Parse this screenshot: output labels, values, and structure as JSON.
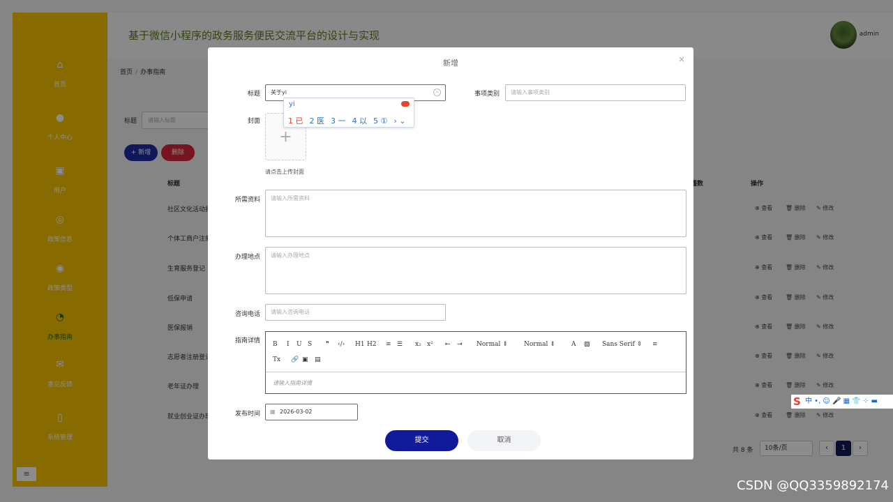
{
  "app": {
    "title": "基于微信小程序的政务服务便民交流平台的设计与实现",
    "username": "admin"
  },
  "sidebar": {
    "items": [
      {
        "label": "首页",
        "icon": "home-icon",
        "glyph": "⌂"
      },
      {
        "label": "个人中心",
        "icon": "user-icon",
        "glyph": "●"
      },
      {
        "label": "用户",
        "icon": "users-icon",
        "glyph": "▣"
      },
      {
        "label": "政策信息",
        "icon": "policy-icon",
        "glyph": "◎"
      },
      {
        "label": "政策类型",
        "icon": "category-icon",
        "glyph": "◉"
      },
      {
        "label": "办事指南",
        "icon": "guide-icon",
        "glyph": "◔"
      },
      {
        "label": "意见反馈",
        "icon": "mail-icon",
        "glyph": "✉"
      },
      {
        "label": "系统管理",
        "icon": "system-icon",
        "glyph": "▯"
      }
    ],
    "toggle_glyph": "≡"
  },
  "breadcrumb": {
    "home": "首页",
    "sep": "/",
    "current": "办事指南"
  },
  "search": {
    "label": "标题",
    "placeholder": "请输入标题"
  },
  "actions": {
    "add": "+ 新增",
    "delete": "删除"
  },
  "table": {
    "headers": {
      "title": "标题",
      "count": "播数",
      "ops": "操作"
    },
    "rows": [
      {
        "title": "社区文化活动报"
      },
      {
        "title": "个体工商户注册"
      },
      {
        "title": "生育服务登记"
      },
      {
        "title": "低保申请"
      },
      {
        "title": "医保报销"
      },
      {
        "title": "志愿者注册登记"
      },
      {
        "title": "老年证办理"
      },
      {
        "title": "就业创业证办理"
      }
    ],
    "row_actions": {
      "view": "⊕ 查看",
      "delete": "🗑 删除",
      "edit": "✎ 修改"
    }
  },
  "pager": {
    "total": "共 8 条",
    "size": "10条/页",
    "prev": "‹",
    "current": "1",
    "next": "›"
  },
  "modal": {
    "title": "新增",
    "close": "×",
    "fields": {
      "title_label": "标题",
      "title_value": "关于yi",
      "category_label": "事项类别",
      "category_placeholder": "请输入事项类别",
      "cover_label": "封面",
      "cover_hint": "请点击上传封面",
      "materials_label": "所需资料",
      "materials_placeholder": "请输入所需资料",
      "location_label": "办理地点",
      "location_placeholder": "请输入办理地点",
      "phone_label": "咨询电话",
      "phone_placeholder": "请输入咨询电话",
      "detail_label": "指南详情",
      "detail_placeholder": "请输入指南详情",
      "date_label": "发布时间",
      "date_value": "2026-03-02"
    },
    "editor_toolbar": {
      "row1": [
        "B",
        "I",
        "U",
        "S",
        "❞",
        "‹/›",
        "H1",
        "H2",
        "≡",
        "☰",
        "x₂",
        "x²",
        "⇤",
        "⇥",
        "Normal ⇕",
        "Normal ⇕",
        "A",
        "▧",
        "Sans Serif ⇕",
        "≡"
      ],
      "row2": [
        "Tx",
        "🔗",
        "▣",
        "▤"
      ]
    },
    "submit": "提交",
    "cancel": "取消"
  },
  "ime": {
    "typed": "yi",
    "candidates": [
      "1 已",
      "2 医",
      "3 一",
      "4 以",
      "5 ①"
    ],
    "nav": "› ⌄"
  },
  "ime_bar": {
    "logo": "S",
    "items": "中 •, ☺ 🎤 ▦ 👕 ⁘ ▬"
  },
  "watermark": "CSDN @QQ3359892174"
}
